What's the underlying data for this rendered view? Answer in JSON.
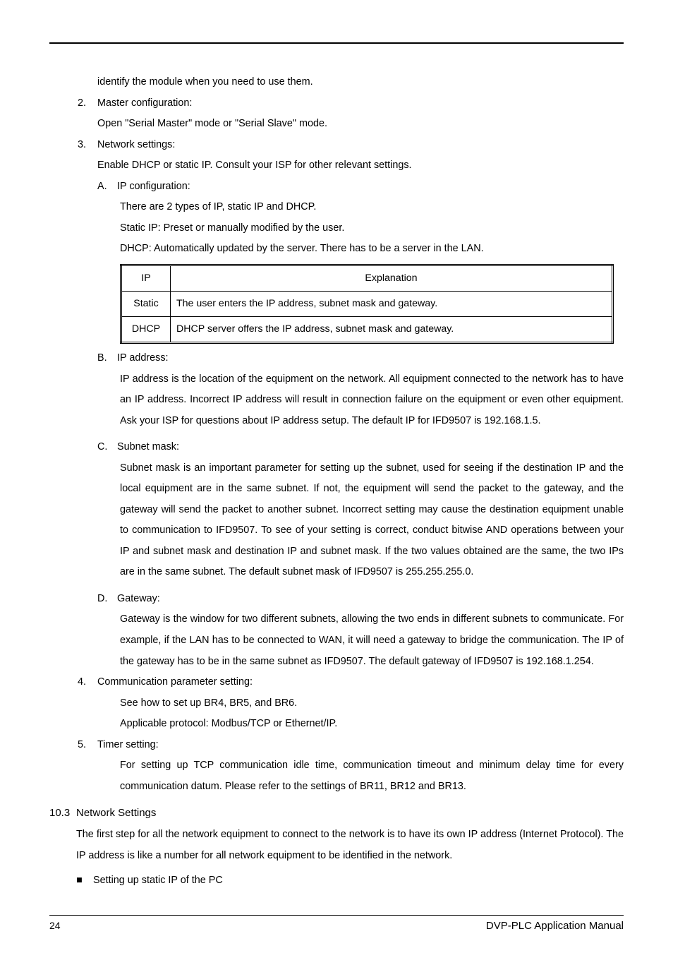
{
  "para_identify": "identify the module when you need to use them.",
  "item2": {
    "num": "2.",
    "title": "Master configuration:",
    "line": "Open \"Serial Master\" mode or \"Serial Slave\" mode."
  },
  "item3": {
    "num": "3.",
    "title": "Network settings:",
    "line": "Enable DHCP or static IP. Consult your ISP for other relevant settings."
  },
  "subA": {
    "let": "A.",
    "title": "IP configuration:",
    "l1": "There are 2 types of IP, static IP and DHCP.",
    "l2": "Static IP: Preset or manually modified by the user.",
    "l3": "DHCP: Automatically updated by the server. There has to be a server in the LAN."
  },
  "table": {
    "h1": "IP",
    "h2": "Explanation",
    "r1c1": "Static",
    "r1c2": "The user enters the IP address, subnet mask and gateway.",
    "r2c1": "DHCP",
    "r2c2": "DHCP server offers the IP address, subnet mask and gateway."
  },
  "subB": {
    "let": "B.",
    "title": "IP address:",
    "body": "IP address is the location of the equipment on the network. All equipment connected to the network has to have an IP address. Incorrect IP address will result in connection failure on the equipment or even other equipment. Ask your ISP for questions about IP address setup. The default IP for IFD9507 is 192.168.1.5."
  },
  "subC": {
    "let": "C.",
    "title": "Subnet mask:",
    "body": "Subnet mask is an important parameter for setting up the subnet, used for seeing if the destination IP and the local equipment are in the same subnet. If not, the equipment will send the packet to the gateway, and the gateway will send the packet to another subnet. Incorrect setting may cause the destination equipment unable to communication to IFD9507. To see of your setting is correct, conduct bitwise AND operations between your IP and subnet mask and destination IP and subnet mask. If the two values obtained are the same, the two IPs are in the same subnet. The default subnet mask of IFD9507 is 255.255.255.0."
  },
  "subD": {
    "let": "D.",
    "title": "Gateway:",
    "body": "Gateway is the window for two different subnets, allowing the two ends in different subnets to communicate. For example, if the LAN has to be connected to WAN, it will need a gateway to bridge the communication. The IP of the gateway has to be in the same subnet as IFD9507. The default gateway of IFD9507 is 192.168.1.254."
  },
  "item4": {
    "num": "4.",
    "title": "Communication parameter setting:",
    "l1": "See how to set up BR4, BR5, and BR6.",
    "l2": "Applicable protocol: Modbus/TCP or Ethernet/IP."
  },
  "item5": {
    "num": "5.",
    "title": "Timer setting:",
    "body": "For setting up TCP communication idle time, communication timeout and minimum delay time for every communication datum. Please refer to the settings of BR11, BR12 and BR13."
  },
  "section": {
    "num": "10.3",
    "title": "Network Settings",
    "intro": "The first step for all the network equipment to connect to the network is to have its own IP address (Internet Protocol). The IP address is like a number for all network equipment to be identified in the network."
  },
  "bullet": {
    "sym": "■",
    "text": "Setting up static IP of the PC"
  },
  "footer": {
    "page": "24",
    "manual": "DVP-PLC  Application  Manual"
  }
}
